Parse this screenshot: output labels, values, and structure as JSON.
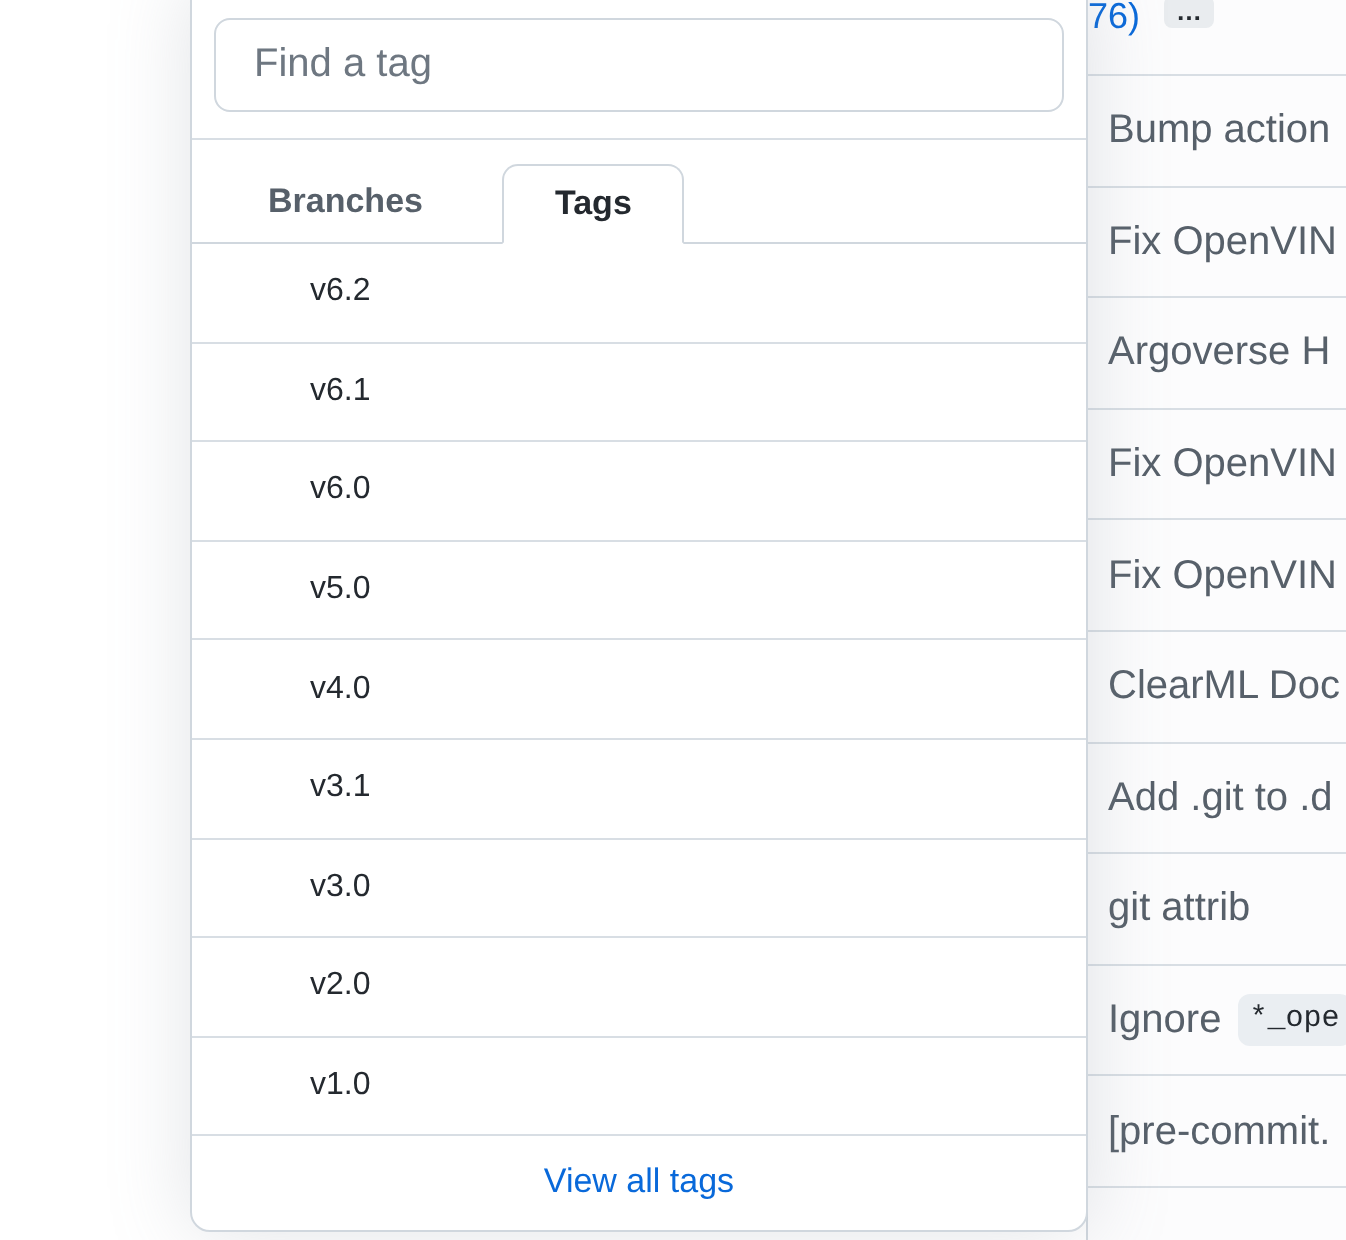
{
  "search": {
    "placeholder": "Find a tag"
  },
  "tabs": [
    {
      "label": "Branches",
      "selected": false
    },
    {
      "label": "Tags",
      "selected": true
    }
  ],
  "tags": [
    "v6.2",
    "v6.1",
    "v6.0",
    "v5.0",
    "v4.0",
    "v3.1",
    "v3.0",
    "v2.0",
    "v1.0"
  ],
  "footer_link": "View all tags",
  "background": {
    "top_link": "76)",
    "more_button": "…",
    "commits": [
      {
        "message": "Bump action"
      },
      {
        "message": "Fix OpenVIN"
      },
      {
        "message": "Argoverse H"
      },
      {
        "message": "Fix OpenVIN"
      },
      {
        "message": "Fix OpenVIN"
      },
      {
        "message": "ClearML Doc"
      },
      {
        "message": "Add .git to .d"
      },
      {
        "message": "git attrib"
      },
      {
        "message": "Ignore",
        "code": "*_ope"
      },
      {
        "message": "[pre-commit."
      }
    ]
  }
}
